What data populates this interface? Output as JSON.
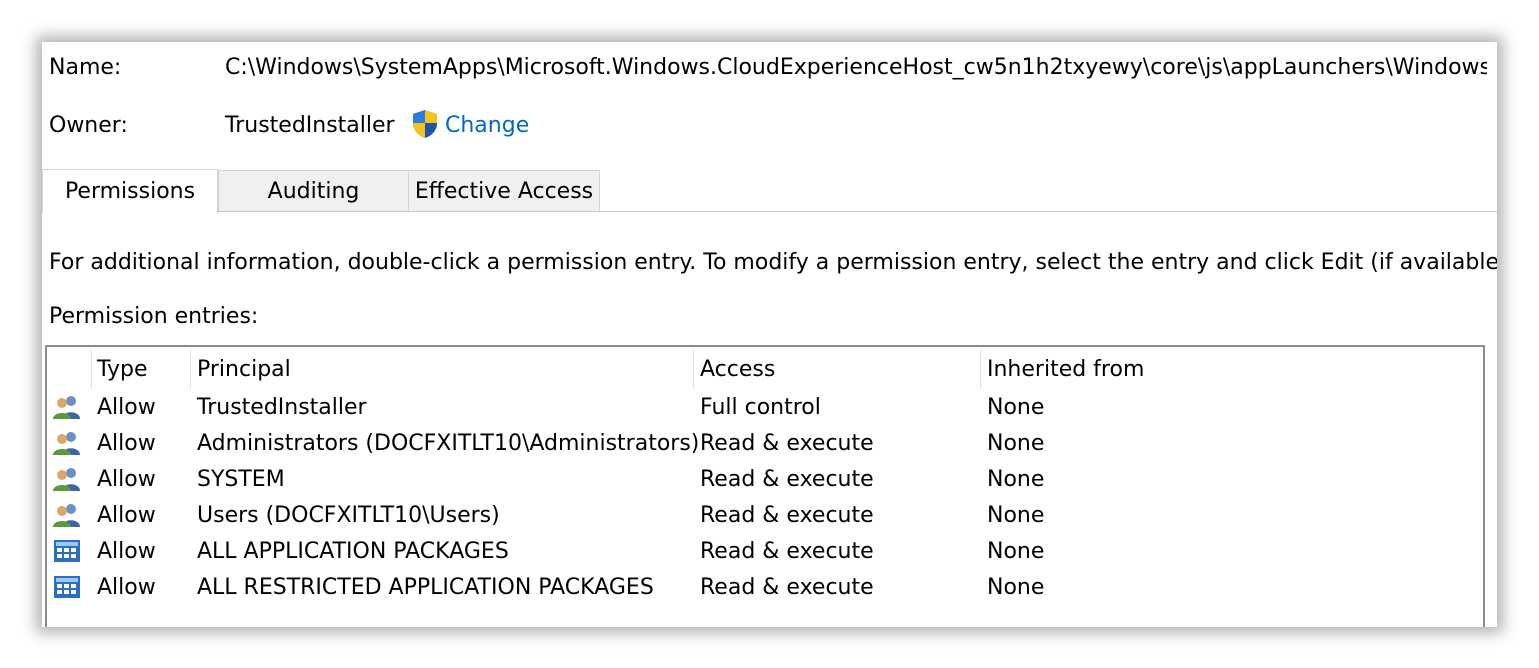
{
  "header": {
    "name_label": "Name:",
    "name_value": "C:\\Windows\\SystemApps\\Microsoft.Windows.CloudExperienceHost_cw5n1h2txyewy\\core\\js\\appLaunchers\\WindowsCor",
    "owner_label": "Owner:",
    "owner_value": "TrustedInstaller",
    "change_label": "Change"
  },
  "tabs": [
    {
      "label": "Permissions",
      "active": true
    },
    {
      "label": "Auditing",
      "active": false
    },
    {
      "label": "Effective Access",
      "active": false
    }
  ],
  "info_text": "For additional information, double-click a permission entry. To modify a permission entry, select the entry and click Edit (if available).",
  "entries_label": "Permission entries:",
  "table": {
    "columns": [
      "Type",
      "Principal",
      "Access",
      "Inherited from"
    ],
    "rows": [
      {
        "icon": "users-icon",
        "type": "Allow",
        "principal": "TrustedInstaller",
        "access": "Full control",
        "inherited": "None"
      },
      {
        "icon": "users-icon",
        "type": "Allow",
        "principal": "Administrators (DOCFXITLT10\\Administrators)",
        "access": "Read & execute",
        "inherited": "None"
      },
      {
        "icon": "users-icon",
        "type": "Allow",
        "principal": "SYSTEM",
        "access": "Read & execute",
        "inherited": "None"
      },
      {
        "icon": "users-icon",
        "type": "Allow",
        "principal": "Users (DOCFXITLT10\\Users)",
        "access": "Read & execute",
        "inherited": "None"
      },
      {
        "icon": "app-packages-icon",
        "type": "Allow",
        "principal": "ALL APPLICATION PACKAGES",
        "access": "Read & execute",
        "inherited": "None"
      },
      {
        "icon": "app-packages-icon",
        "type": "Allow",
        "principal": "ALL RESTRICTED APPLICATION PACKAGES",
        "access": "Read & execute",
        "inherited": "None"
      }
    ]
  },
  "colors": {
    "link": "#0066cc",
    "list_border": "#8c8c8c",
    "tab_inactive": "#f0f0f0"
  }
}
